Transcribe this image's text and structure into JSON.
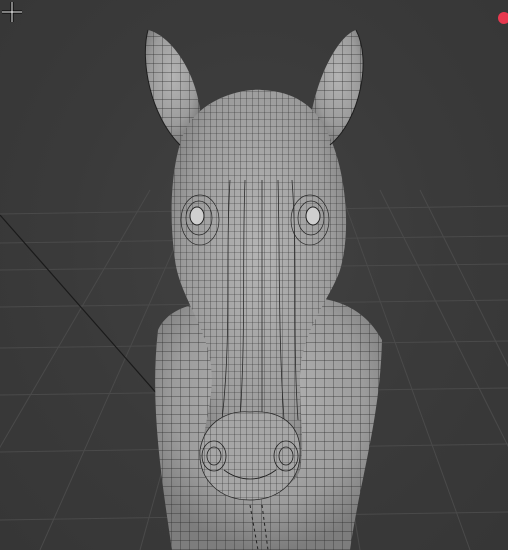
{
  "editor": {
    "type": "3D Viewport",
    "shading": "solid-wireframe",
    "object": "horse-head-mesh"
  },
  "colors": {
    "background": "#393939",
    "grid_line": "#4a4a4a",
    "mesh_fill": "#9a9a9a",
    "mesh_wire": "#2a2a2a",
    "x_axis": "#1a1a1a",
    "y_axis": "#7fb34a",
    "record_dot": "#e8394f"
  },
  "icons": {
    "cursor": "crosshair-cursor-icon",
    "status": "recording-dot-icon"
  }
}
